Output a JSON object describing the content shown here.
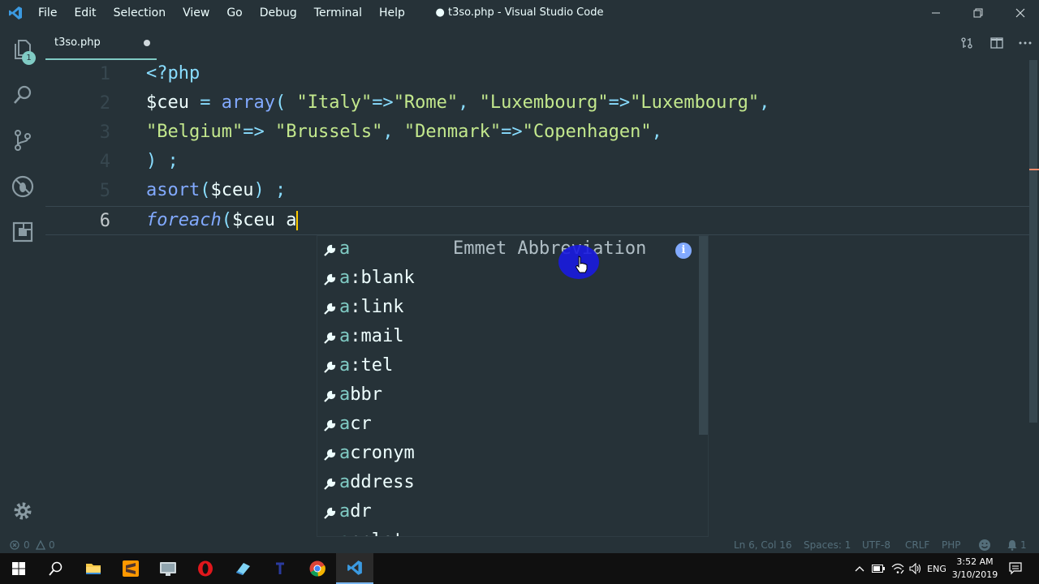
{
  "app": {
    "window_title": "● t3so.php - Visual Studio Code",
    "menu": [
      "File",
      "Edit",
      "Selection",
      "View",
      "Go",
      "Debug",
      "Terminal",
      "Help"
    ]
  },
  "activity_bar": {
    "explorer_badge": "1"
  },
  "tab": {
    "name": "t3so.php"
  },
  "editor": {
    "lines": [
      {
        "num": "1"
      },
      {
        "num": "2"
      },
      {
        "num": "3"
      },
      {
        "num": "4"
      },
      {
        "num": "5"
      },
      {
        "num": "6"
      }
    ],
    "code": {
      "l1": "<?php",
      "l2_var": "$ceu",
      "l2_eq": " = ",
      "l2_fn": "array",
      "l2_p": "( ",
      "l2_s1": "\"Italy\"",
      "l2_a1": "=>",
      "l2_s2": "\"Rome\"",
      "l2_c1": ", ",
      "l2_s3": "\"Luxembourg\"",
      "l2_a2": "=>",
      "l2_s4": "\"Luxembourg\"",
      "l2_c2": ",",
      "l3_s1": "\"Belgium\"",
      "l3_a1": "=>",
      "l3_s2": " \"Brussels\"",
      "l3_c1": ", ",
      "l3_s3": "\"Denmark\"",
      "l3_a2": "=>",
      "l3_s4": "\"Copenhagen\"",
      "l3_c2": ",",
      "l4": ") ;",
      "l5_fn": "asort",
      "l5_p1": "(",
      "l5_var": "$ceu",
      "l5_p2": ") ;",
      "l6_kw": "foreach",
      "l6_p": "(",
      "l6_var": "$ceu ",
      "l6_typed": "a"
    }
  },
  "suggest": {
    "items": [
      {
        "match": "a",
        "rest": ""
      },
      {
        "match": "a",
        "rest": ":blank"
      },
      {
        "match": "a",
        "rest": ":link"
      },
      {
        "match": "a",
        "rest": ":mail"
      },
      {
        "match": "a",
        "rest": ":tel"
      },
      {
        "match": "a",
        "rest": "bbr"
      },
      {
        "match": "a",
        "rest": "cr"
      },
      {
        "match": "a",
        "rest": "cronym"
      },
      {
        "match": "a",
        "rest": "ddress"
      },
      {
        "match": "a",
        "rest": "dr"
      },
      {
        "match": "a",
        "rest": "pplet"
      }
    ],
    "detail": "Emmet Abbreviation",
    "info_glyph": "i"
  },
  "status": {
    "errors": "0",
    "warnings": "0",
    "position": "Ln 6, Col 16",
    "spaces": "Spaces: 1",
    "encoding": "UTF-8",
    "eol": "CRLF",
    "language": "PHP",
    "notifications": "1"
  },
  "taskbar": {
    "language": "ENG",
    "time": "3:52 AM",
    "date": "3/10/2019"
  }
}
